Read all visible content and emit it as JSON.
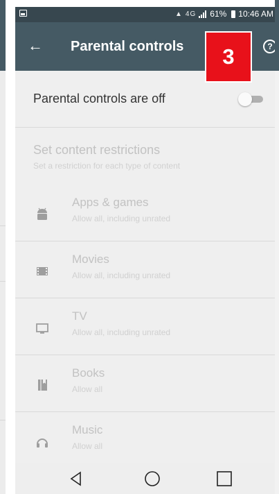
{
  "status_bar": {
    "network": "4G",
    "battery": "61%",
    "time": "10:46 AM"
  },
  "app_bar": {
    "title": "Parental controls"
  },
  "step_badge": "3",
  "master_toggle": {
    "label": "Parental controls are off",
    "state": "off"
  },
  "restrictions": {
    "title": "Set content restrictions",
    "subtitle": "Set a restriction for each type of content"
  },
  "categories": [
    {
      "name": "Apps & games",
      "desc": "Allow all, including unrated",
      "icon": "android-icon"
    },
    {
      "name": "Movies",
      "desc": "Allow all, including unrated",
      "icon": "film-icon"
    },
    {
      "name": "TV",
      "desc": "Allow all, including unrated",
      "icon": "tv-icon"
    },
    {
      "name": "Books",
      "desc": "Allow all",
      "icon": "book-icon"
    },
    {
      "name": "Music",
      "desc": "Allow all",
      "icon": "headphones-icon"
    }
  ],
  "colors": {
    "app_bar": "#455a64",
    "status_bar": "#37474f",
    "badge": "#e8111a"
  }
}
